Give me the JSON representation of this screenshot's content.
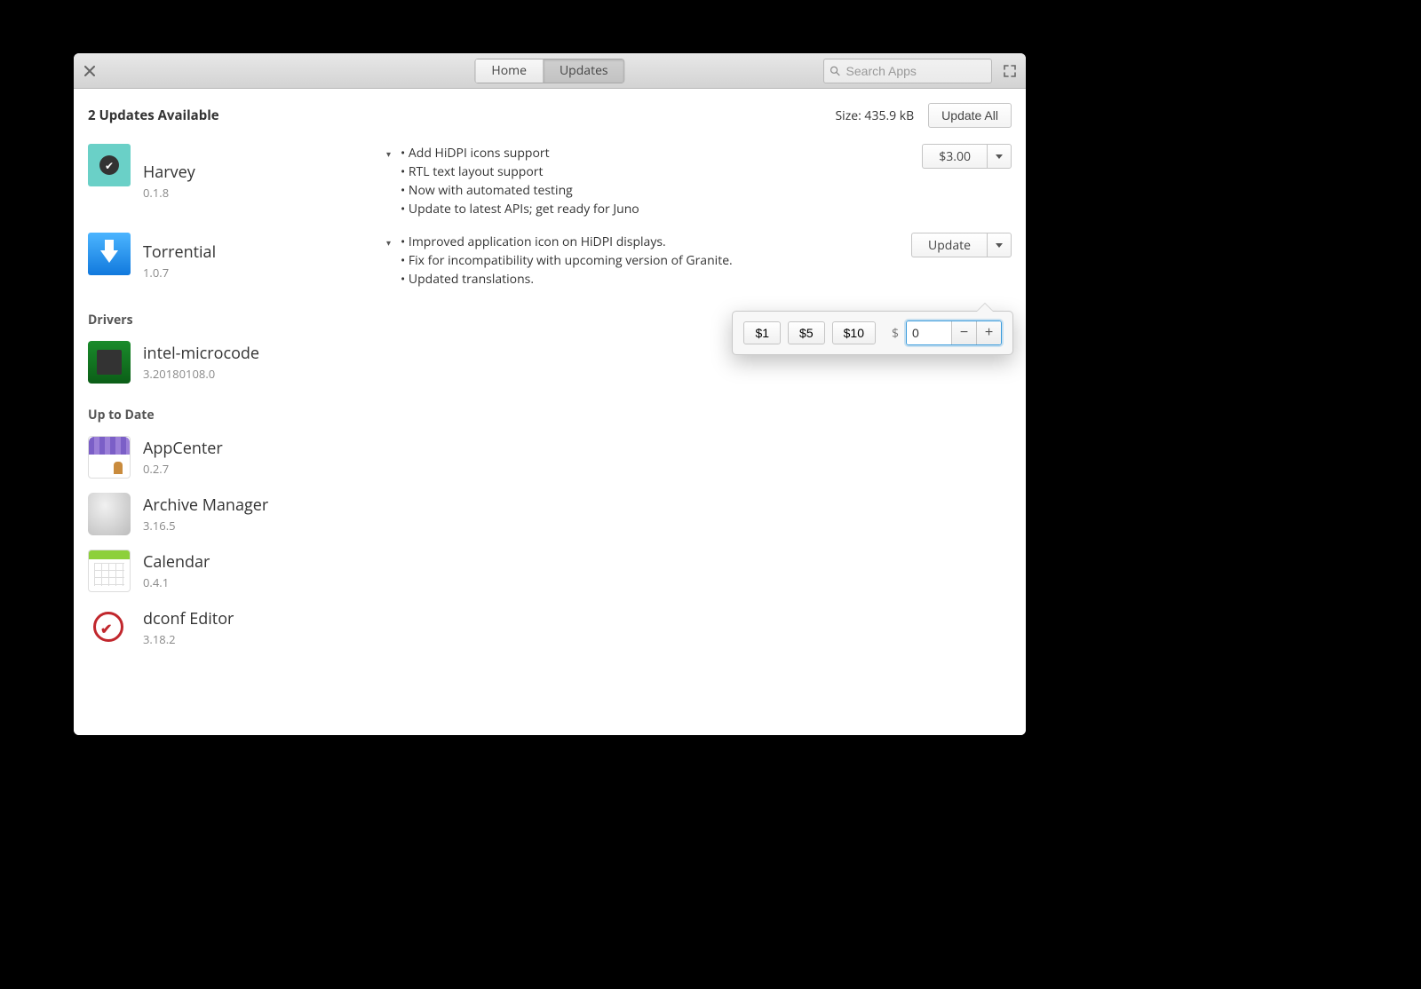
{
  "toolbar": {
    "tabs": {
      "home": "Home",
      "updates": "Updates"
    },
    "search_placeholder": "Search Apps"
  },
  "header": {
    "count_text": "2 Updates Available",
    "size_text": "Size: 435.9 kB",
    "update_all_label": "Update All"
  },
  "updates": [
    {
      "name": "Harvey",
      "version": "0.1.8",
      "button_label": "$3.00",
      "changelog": [
        "Add HiDPI icons support",
        "RTL text layout support",
        "Now with automated testing",
        "Update to latest APIs; get ready for Juno"
      ]
    },
    {
      "name": "Torrential",
      "version": "1.0.7",
      "button_label": "Update",
      "changelog": [
        "Improved application icon on HiDPI displays.",
        "Fix for incompatibility with upcoming version of Granite.",
        "Updated translations."
      ]
    }
  ],
  "drivers_title": "Drivers",
  "drivers": [
    {
      "name": "intel-microcode",
      "version": "3.20180108.0"
    }
  ],
  "uptodate_title": "Up to Date",
  "uptodate": [
    {
      "name": "AppCenter",
      "version": "0.2.7"
    },
    {
      "name": "Archive Manager",
      "version": "3.16.5"
    },
    {
      "name": "Calendar",
      "version": "0.4.1"
    },
    {
      "name": "dconf Editor",
      "version": "3.18.2"
    }
  ],
  "popover": {
    "presets": [
      "$1",
      "$5",
      "$10"
    ],
    "currency": "$",
    "custom_value": "0"
  }
}
